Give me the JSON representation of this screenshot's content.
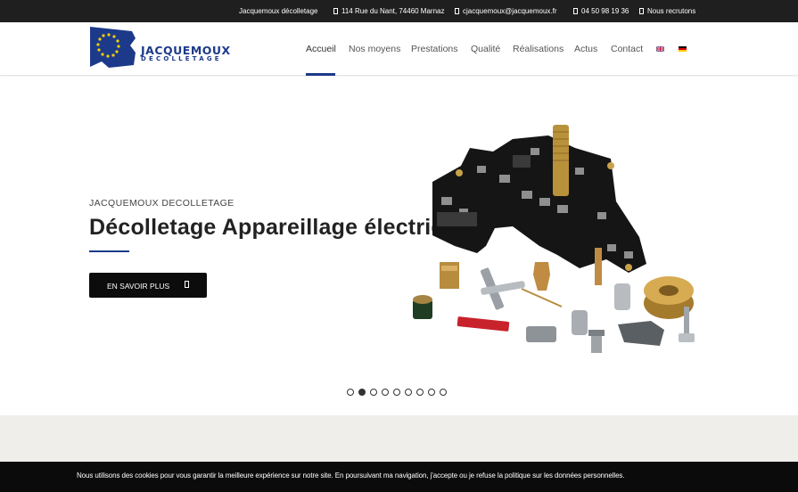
{
  "topbar": {
    "company": "Jacquemoux décolletage",
    "address": "114 Rue du Nant, 74460 Marnaz",
    "email": "cjacquemoux@jacquemoux.fr",
    "phone": "04 50 98 19 36",
    "jobs": "Nous recrutons"
  },
  "logo": {
    "line1": "JACQUEMOUX",
    "line2": "DECOLLETAGE"
  },
  "nav": {
    "items": [
      {
        "label": "Accueil"
      },
      {
        "label": "Nos moyens"
      },
      {
        "label": "Prestations"
      },
      {
        "label": "Qualité"
      },
      {
        "label": "Réalisations"
      },
      {
        "label": "Actus"
      },
      {
        "label": "Contact"
      }
    ],
    "active_index": 0
  },
  "hero": {
    "eyebrow": "JACQUEMOUX DECOLLETAGE",
    "headline": "Décolletage Appareillage électrique",
    "cta_label": "EN SAVOIR PLUS",
    "slide_count": 9,
    "active_slide": 2
  },
  "cookie": {
    "text": "Nous utilisons des cookies pour vous garantir la meilleure expérience sur notre site. En poursuivant ma navigation, j'accepte ou je refuse la politique sur les données personnelles."
  },
  "colors": {
    "brand_blue": "#1d3a8a",
    "topbar": "#1f1f1f",
    "gold": "#c9a14a"
  }
}
